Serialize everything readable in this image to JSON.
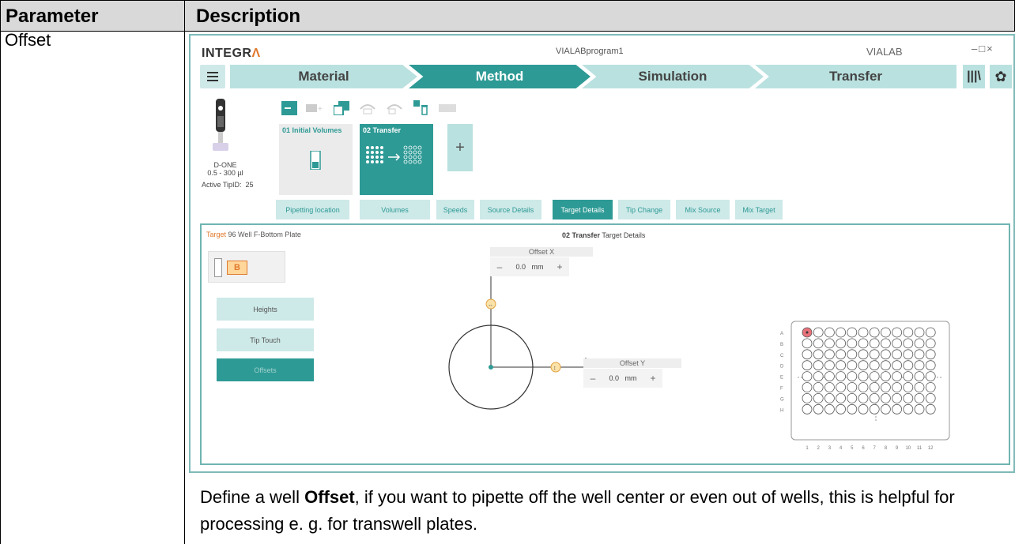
{
  "table": {
    "header_param": "Parameter",
    "header_desc": "Description",
    "param_name": "Offset",
    "desc_prefix": "Define a well ",
    "desc_bold": "Offset",
    "desc_suffix": ", if you want to pipette off the well center or even out of wells, this is helpful for processing e. g. for transwell plates."
  },
  "app": {
    "logo_main": "INTEGR",
    "logo_accent": "Λ",
    "window_title": "VIALABprogram1",
    "brand": "VIALAB",
    "window_controls": "–□×",
    "steps": [
      "Material",
      "Method",
      "Simulation",
      "Transfer"
    ],
    "active_step": "Method",
    "pipette": {
      "model": "D-ONE",
      "range": "0.5 - 300 µl",
      "tip_label": "Active TipID:",
      "tip_value": "25"
    },
    "program_cards": [
      {
        "title": "01 Initial Volumes"
      },
      {
        "title": "02 Transfer"
      }
    ],
    "add_step": "+",
    "tabs": [
      "Pipetting location",
      "Volumes",
      "Speeds",
      "Source Details",
      "Target Details",
      "Tip Change",
      "Mix Source",
      "Mix Target"
    ],
    "active_tab": "Target Details",
    "panel": {
      "target_prefix": "Target",
      "target_plate": " 96 Well F-Bottom Plate",
      "title_bold": "02 Transfer",
      "title_rest": " Target Details",
      "plate_letter": "B",
      "side_buttons": [
        "Heights",
        "Tip Touch",
        "Offsets"
      ],
      "active_side": "Offsets",
      "offset_x": {
        "label": "Offset X",
        "minus": "–",
        "value": "0.0",
        "unit": "mm",
        "plus": "+"
      },
      "offset_y": {
        "label": "Offset Y",
        "minus": "–",
        "value": "0.0",
        "unit": "mm",
        "plus": "+"
      },
      "row_labels": [
        "A",
        "B",
        "C",
        "D",
        "E",
        "F",
        "G",
        "H"
      ],
      "col_labels": [
        "1",
        "2",
        "3",
        "4",
        "5",
        "6",
        "7",
        "8",
        "9",
        "10",
        "11",
        "12"
      ],
      "selected_well": "A1"
    }
  },
  "colors": {
    "accent": "#2e9a95",
    "light": "#b9e1df",
    "orange": "#e07a2d",
    "well_sel": "#e8727a"
  }
}
